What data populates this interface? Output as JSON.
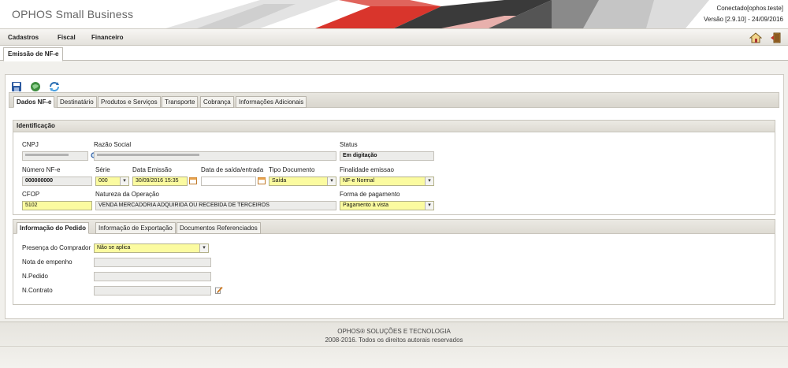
{
  "app": {
    "title": "OPHOS Small Business",
    "connected": "Conectado[ophos.teste]",
    "version": "Versão [2.9.10] - 24/09/2016"
  },
  "menu": {
    "items": [
      "Cadastros",
      "Fiscal",
      "Financeiro"
    ],
    "icons": [
      "home-icon",
      "logout-icon"
    ]
  },
  "page_tab": {
    "label": "Emissão de NF-e"
  },
  "toolbar": {
    "icons": [
      "save-icon",
      "transmit-icon",
      "refresh-icon"
    ]
  },
  "tabs": [
    {
      "label": "Dados NF-e",
      "active": true
    },
    {
      "label": "Destinatário"
    },
    {
      "label": "Produtos e Serviços"
    },
    {
      "label": "Transporte"
    },
    {
      "label": "Cobrança"
    },
    {
      "label": "Informações Adicionais"
    }
  ],
  "identificacao": {
    "legend": "Identificação",
    "cnpj": {
      "label": "CNPJ",
      "value": ""
    },
    "razao_social": {
      "label": "Razão Social",
      "value": ""
    },
    "status": {
      "label": "Status",
      "value": "Em digitação"
    },
    "numero_nfe": {
      "label": "Número NF-e",
      "value": "000000000"
    },
    "serie": {
      "label": "Série",
      "value": "000"
    },
    "data_emissao": {
      "label": "Data Emissão",
      "value": "30/09/2016 15:35"
    },
    "data_saida": {
      "label": "Data de saída/entrada",
      "value": ""
    },
    "tipo_documento": {
      "label": "Tipo Documento",
      "value": "Saída"
    },
    "finalidade": {
      "label": "Finalidade emissao",
      "value": "NF-e Normal"
    },
    "cfop": {
      "label": "CFOP",
      "value": "5102"
    },
    "natureza": {
      "label": "Natureza da Operação",
      "value": "VENDA MERCADORIA ADQUIRIDA OU RECEBIDA DE TERCEIROS"
    },
    "forma_pagamento": {
      "label": "Forma de pagamento",
      "value": "Pagamento à vista"
    }
  },
  "pedido_tabs": [
    {
      "label": "Informação do Pedido",
      "active": true
    },
    {
      "label": "Informação de Exportação"
    },
    {
      "label": "Documentos Referenciados"
    }
  ],
  "pedido": {
    "presenca": {
      "label": "Presença do Comprador",
      "value": "Não se aplica"
    },
    "nota_empenho": {
      "label": "Nota de empenho",
      "value": ""
    },
    "n_pedido": {
      "label": "N.Pedido",
      "value": ""
    },
    "n_contrato": {
      "label": "N.Contrato",
      "value": ""
    }
  },
  "footer": {
    "line1": "OPHOS® SOLUÇÕES E TECNOLOGIA",
    "line2": "2008-2016. Todos os direitos autorais reservados"
  },
  "colors": {
    "accent_red": "#d9352c",
    "field_yellow": "#fbfba0",
    "field_gray": "#ececea",
    "tab_bar": "#d9d6ce"
  }
}
